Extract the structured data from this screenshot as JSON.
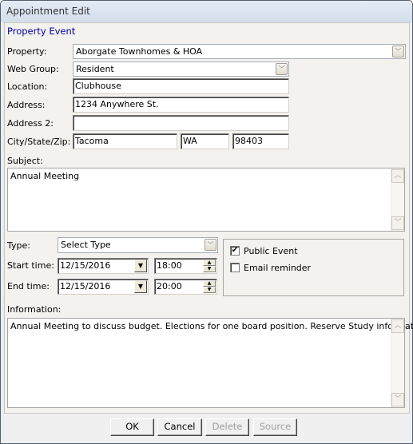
{
  "window": {
    "title": "Appointment Edit"
  },
  "section_title": "Property Event",
  "fields": {
    "property": {
      "label": "Property:",
      "value": "Aborgate Townhomes & HOA"
    },
    "web_group": {
      "label": "Web Group:",
      "value": "Resident"
    },
    "location": {
      "label": "Location:",
      "value": "Clubhouse"
    },
    "address": {
      "label": "Address:",
      "value": "1234 Anywhere St."
    },
    "address2": {
      "label": "Address 2:",
      "value": ""
    },
    "city_state_zip": {
      "label": "City/State/Zip:",
      "city": "Tacoma",
      "state": "WA",
      "zip": "98403"
    },
    "subject": {
      "label": "Subject:",
      "value": "Annual Meeting"
    },
    "type": {
      "label": "Type:",
      "value": "Select Type"
    },
    "start": {
      "label": "Start time:",
      "date": "12/15/2016",
      "time": "18:00"
    },
    "end": {
      "label": "End time:",
      "date": "12/15/2016",
      "time": "20:00"
    },
    "information": {
      "label": "Information:",
      "value": "Annual Meeting to discuss budget. Elections for one board position. Reserve Study information."
    }
  },
  "options": {
    "public_event": {
      "label": "Public Event",
      "checked": true
    },
    "email_reminder": {
      "label": "Email reminder",
      "checked": false
    }
  },
  "buttons": {
    "ok": "OK",
    "cancel": "Cancel",
    "delete": "Delete",
    "source": "Source"
  },
  "icons": {
    "check": "✔",
    "chevron_down": "﹀",
    "chevron_up": "︿",
    "triangle_down": "▼",
    "spin_up": "▲",
    "spin_down": "▼"
  },
  "colors": {
    "section_title": "#0000a0",
    "panel_bg": "#f4f2ee"
  }
}
